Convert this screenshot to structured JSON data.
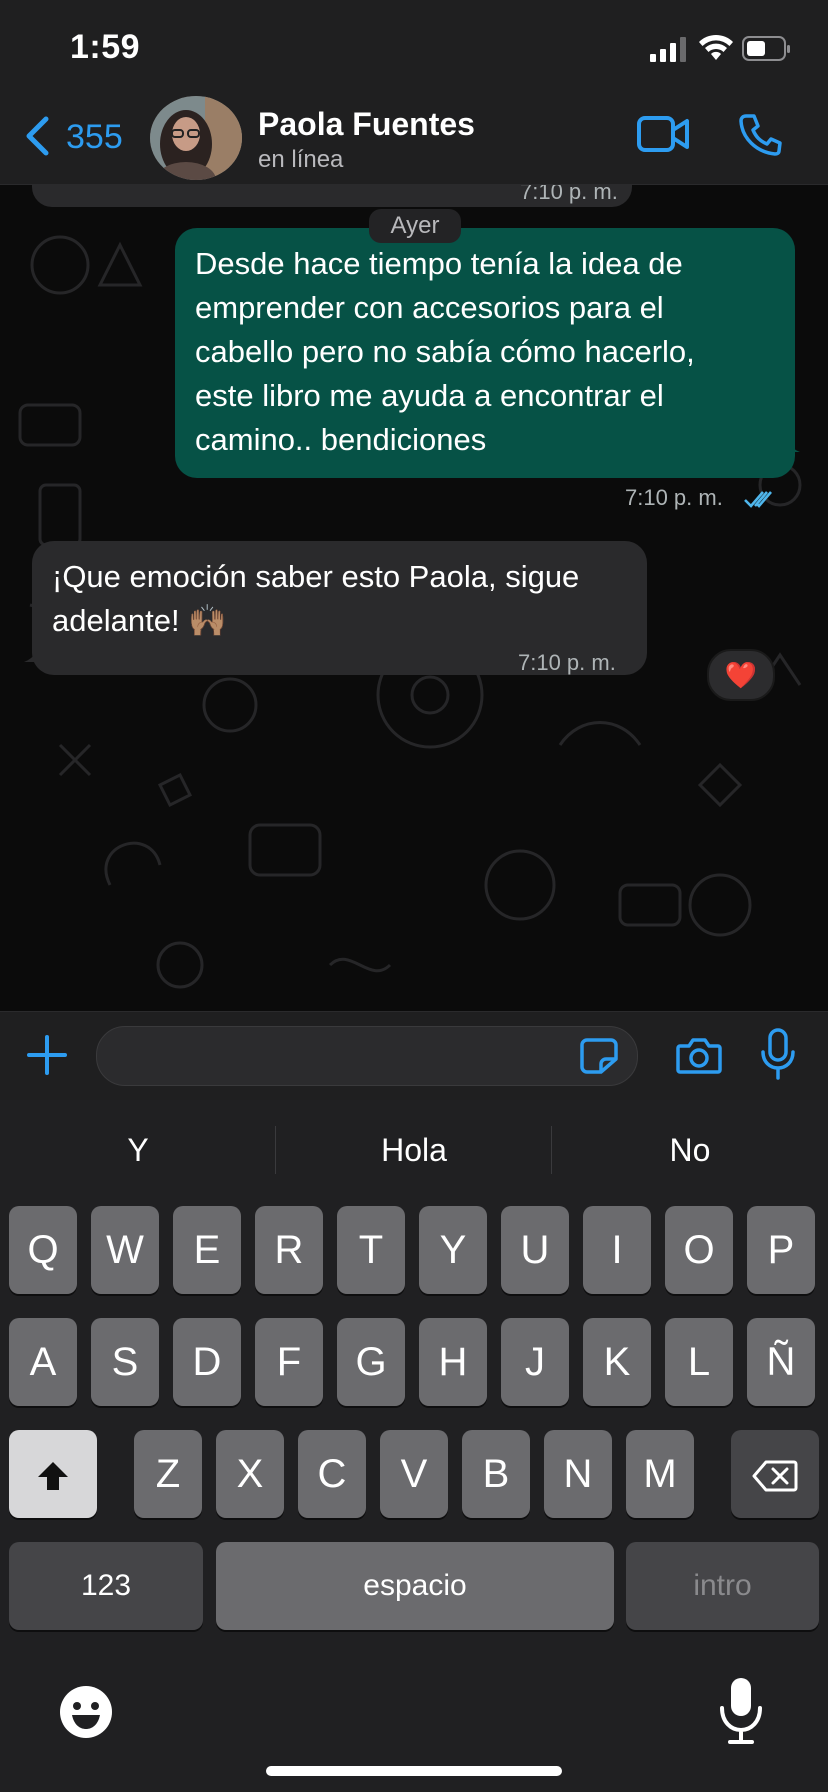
{
  "status_bar": {
    "time": "1:59"
  },
  "header": {
    "back_count": "355",
    "contact_name": "Paola Fuentes",
    "contact_status": "en línea"
  },
  "chat": {
    "date_label": "Ayer",
    "partial_prev_time": "7:10 p. m.",
    "messages": [
      {
        "direction": "outgoing",
        "lines": [
          "Desde hace tiempo tenía la idea de",
          "emprender con accesorios para el",
          "cabello pero no sabía cómo hacerlo,",
          "este libro me ayuda a encontrar el",
          "camino.. bendiciones"
        ],
        "time": "7:10 p. m.",
        "status_icon": "double-check-read-icon",
        "reaction": "❤️"
      },
      {
        "direction": "incoming",
        "lines": [
          "¡Que emoción saber esto Paola, sigue",
          "adelante! 🙌🏽"
        ],
        "time": "7:10 p. m."
      }
    ]
  },
  "input": {
    "placeholder": ""
  },
  "keyboard": {
    "suggestions": [
      "Y",
      "Hola",
      "No"
    ],
    "row1": [
      "Q",
      "W",
      "E",
      "R",
      "T",
      "Y",
      "U",
      "I",
      "O",
      "P"
    ],
    "row2": [
      "A",
      "S",
      "D",
      "F",
      "G",
      "H",
      "J",
      "K",
      "L",
      "Ñ"
    ],
    "row3": [
      "Z",
      "X",
      "C",
      "V",
      "B",
      "N",
      "M"
    ],
    "numbers_label": "123",
    "space_label": "espacio",
    "return_label": "intro"
  },
  "colors": {
    "accent": "#2d9cf0",
    "outgoing_bubble": "#065246",
    "incoming_bubble": "#2a2a2c",
    "background": "#0b0b0b"
  }
}
